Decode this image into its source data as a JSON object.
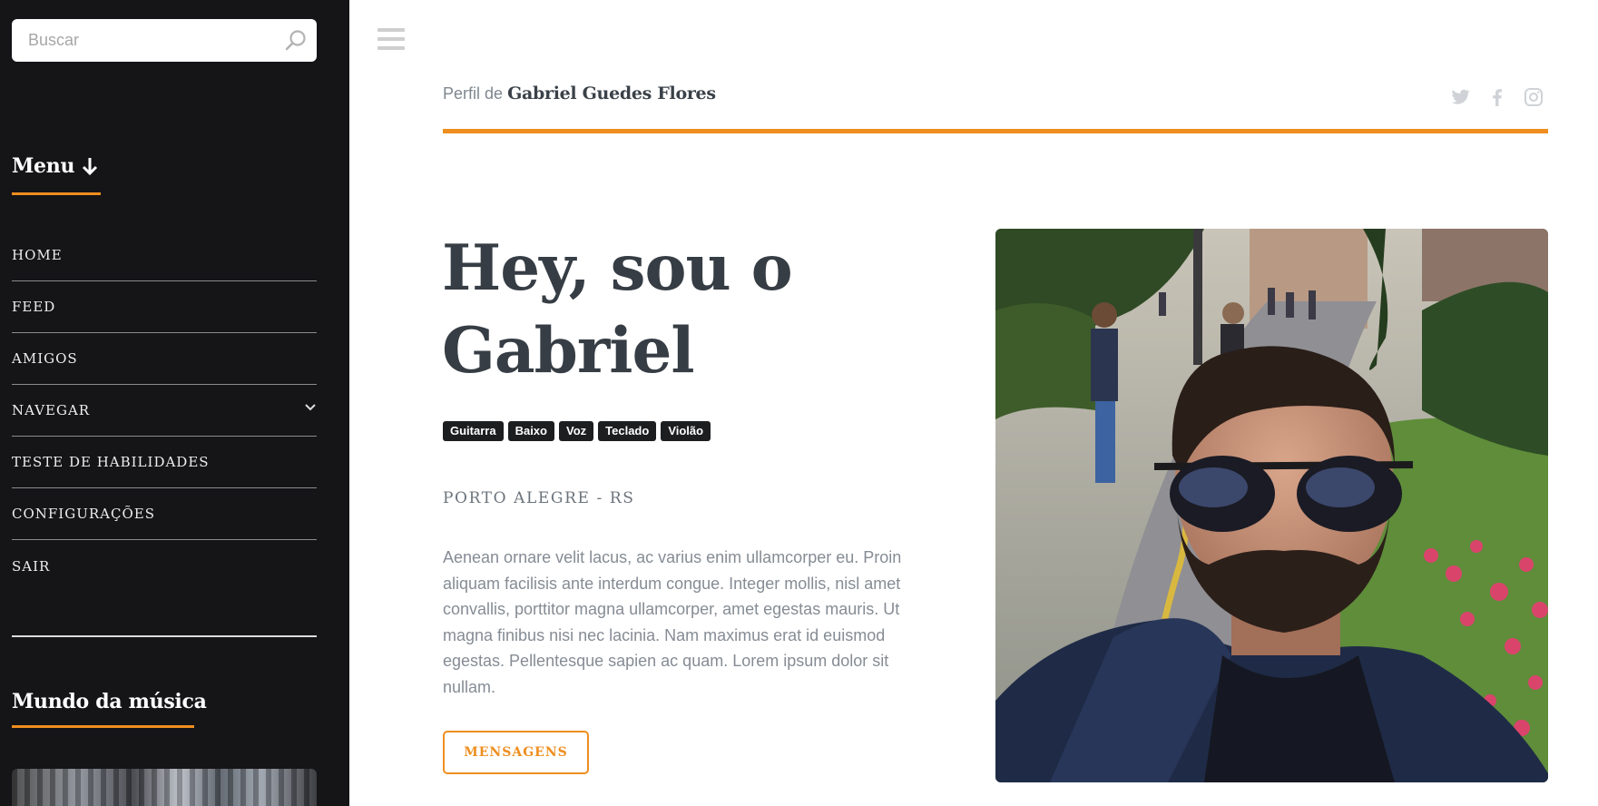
{
  "sidebar": {
    "search": {
      "placeholder": "Buscar"
    },
    "menu_title": "Menu",
    "menu_items": [
      {
        "label": "HOME"
      },
      {
        "label": "FEED"
      },
      {
        "label": "AMIGOS"
      },
      {
        "label": "NAVEGAR",
        "has_submenu": true
      },
      {
        "label": "TESTE DE HABILIDADES"
      },
      {
        "label": "CONFIGURAÇÕES"
      },
      {
        "label": "SAIR"
      }
    ],
    "section_title": "Mundo da música"
  },
  "header": {
    "profile_prefix": "Perfil de",
    "profile_name": "Gabriel Guedes Flores",
    "social_icons": [
      "twitter-icon",
      "facebook-icon",
      "instagram-icon"
    ]
  },
  "main": {
    "hero_line1": "Hey, sou o",
    "hero_line2": "Gabriel",
    "tags": [
      "Guitarra",
      "Baixo",
      "Voz",
      "Teclado",
      "Violão"
    ],
    "location": "PORTO ALEGRE - RS",
    "bio": "Aenean ornare velit lacus, ac varius enim ullamcorper eu. Proin aliquam facilisis ante interdum congue. Integer mollis, nisl amet convallis, porttitor magna ullamcorper, amet egestas mauris. Ut magna finibus nisi nec lacinia. Nam maximus erat id euismod egestas. Pellentesque sapien ac quam. Lorem ipsum dolor sit nullam.",
    "button_label": "MENSAGENS"
  },
  "colors": {
    "accent": "#ee8e1f",
    "sidebar_bg": "#151417",
    "heading": "#363d44",
    "tag_bg": "#1d1e20"
  }
}
